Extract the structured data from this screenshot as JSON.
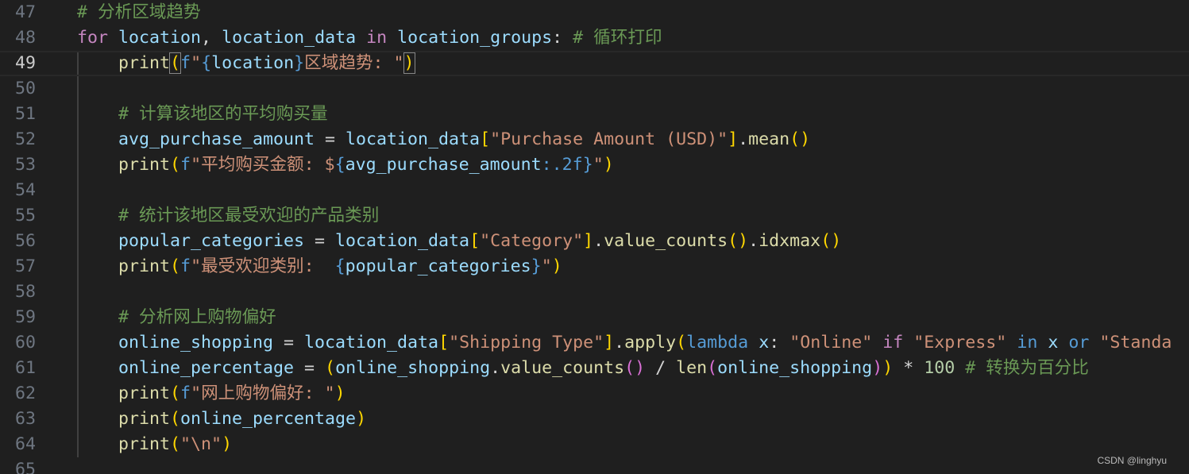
{
  "watermark": "CSDN @linghyu",
  "colors": {
    "background": "#1f1f1f",
    "comment": "#6a9955",
    "keyword": "#c586c0",
    "variable": "#9cdcfe",
    "function": "#dcdcaa",
    "string": "#ce9178",
    "bracket_1": "#ffd700",
    "bracket_2": "#da70d6",
    "bracket_3": "#179fff"
  },
  "current_line": "49",
  "lines": [
    {
      "num": "47",
      "tokens": [
        [
          "cm",
          "# 分析区域趋势"
        ]
      ]
    },
    {
      "num": "48",
      "tokens": [
        [
          "kw",
          "for"
        ],
        [
          "pun",
          " "
        ],
        [
          "var",
          "location"
        ],
        [
          "pun",
          ", "
        ],
        [
          "var",
          "location_data"
        ],
        [
          "pun",
          " "
        ],
        [
          "kw",
          "in"
        ],
        [
          "pun",
          " "
        ],
        [
          "var",
          "location_groups"
        ],
        [
          "pun",
          ": "
        ],
        [
          "cm",
          "# 循环打印"
        ]
      ]
    },
    {
      "num": "49",
      "tokens": [
        [
          "pun",
          "    "
        ],
        [
          "fn",
          "print"
        ],
        [
          "b1 match",
          "("
        ],
        [
          "sk",
          "f"
        ],
        [
          "str",
          "\""
        ],
        [
          "sk",
          "{"
        ],
        [
          "var",
          "location"
        ],
        [
          "sk",
          "}"
        ],
        [
          "str",
          "区域趋势: \""
        ],
        [
          "b1 match",
          ")"
        ]
      ]
    },
    {
      "num": "50",
      "tokens": []
    },
    {
      "num": "51",
      "tokens": [
        [
          "pun",
          "    "
        ],
        [
          "cm",
          "# 计算该地区的平均购买量"
        ]
      ]
    },
    {
      "num": "52",
      "tokens": [
        [
          "pun",
          "    "
        ],
        [
          "var",
          "avg_purchase_amount"
        ],
        [
          "pun",
          " = "
        ],
        [
          "var",
          "location_data"
        ],
        [
          "b1",
          "["
        ],
        [
          "str",
          "\"Purchase Amount (USD)\""
        ],
        [
          "b1",
          "]"
        ],
        [
          "pun",
          "."
        ],
        [
          "fn",
          "mean"
        ],
        [
          "b1",
          "()"
        ]
      ]
    },
    {
      "num": "53",
      "tokens": [
        [
          "pun",
          "    "
        ],
        [
          "fn",
          "print"
        ],
        [
          "b1",
          "("
        ],
        [
          "sk",
          "f"
        ],
        [
          "str",
          "\"平均购买金额: $"
        ],
        [
          "sk",
          "{"
        ],
        [
          "var",
          "avg_purchase_amount"
        ],
        [
          "sk",
          ":.2f}"
        ],
        [
          "str",
          "\""
        ],
        [
          "b1",
          ")"
        ]
      ]
    },
    {
      "num": "54",
      "tokens": []
    },
    {
      "num": "55",
      "tokens": [
        [
          "pun",
          "    "
        ],
        [
          "cm",
          "# 统计该地区最受欢迎的产品类别"
        ]
      ]
    },
    {
      "num": "56",
      "tokens": [
        [
          "pun",
          "    "
        ],
        [
          "var",
          "popular_categories"
        ],
        [
          "pun",
          " = "
        ],
        [
          "var",
          "location_data"
        ],
        [
          "b1",
          "["
        ],
        [
          "str",
          "\"Category\""
        ],
        [
          "b1",
          "]"
        ],
        [
          "pun",
          "."
        ],
        [
          "fn",
          "value_counts"
        ],
        [
          "b1",
          "()"
        ],
        [
          "pun",
          "."
        ],
        [
          "fn",
          "idxmax"
        ],
        [
          "b1",
          "()"
        ]
      ]
    },
    {
      "num": "57",
      "tokens": [
        [
          "pun",
          "    "
        ],
        [
          "fn",
          "print"
        ],
        [
          "b1",
          "("
        ],
        [
          "sk",
          "f"
        ],
        [
          "str",
          "\"最受欢迎类别:  "
        ],
        [
          "sk",
          "{"
        ],
        [
          "var",
          "popular_categories"
        ],
        [
          "sk",
          "}"
        ],
        [
          "str",
          "\""
        ],
        [
          "b1",
          ")"
        ]
      ]
    },
    {
      "num": "58",
      "tokens": []
    },
    {
      "num": "59",
      "tokens": [
        [
          "pun",
          "    "
        ],
        [
          "cm",
          "# 分析网上购物偏好"
        ]
      ]
    },
    {
      "num": "60",
      "tokens": [
        [
          "pun",
          "    "
        ],
        [
          "var",
          "online_shopping"
        ],
        [
          "pun",
          " = "
        ],
        [
          "var",
          "location_data"
        ],
        [
          "b1",
          "["
        ],
        [
          "str",
          "\"Shipping Type\""
        ],
        [
          "b1",
          "]"
        ],
        [
          "pun",
          "."
        ],
        [
          "fn",
          "apply"
        ],
        [
          "b1",
          "("
        ],
        [
          "sk",
          "lambda"
        ],
        [
          "pun",
          " "
        ],
        [
          "var",
          "x"
        ],
        [
          "pun",
          ": "
        ],
        [
          "str",
          "\"Online\""
        ],
        [
          "pun",
          " "
        ],
        [
          "kw",
          "if"
        ],
        [
          "pun",
          " "
        ],
        [
          "str",
          "\"Express\""
        ],
        [
          "pun",
          " "
        ],
        [
          "sk",
          "in"
        ],
        [
          "pun",
          " "
        ],
        [
          "var",
          "x"
        ],
        [
          "pun",
          " "
        ],
        [
          "sk",
          "or"
        ],
        [
          "pun",
          " "
        ],
        [
          "str",
          "\"Standa"
        ]
      ]
    },
    {
      "num": "61",
      "tokens": [
        [
          "pun",
          "    "
        ],
        [
          "var",
          "online_percentage"
        ],
        [
          "pun",
          " = "
        ],
        [
          "b1",
          "("
        ],
        [
          "var",
          "online_shopping"
        ],
        [
          "pun",
          "."
        ],
        [
          "fn",
          "value_counts"
        ],
        [
          "b2",
          "()"
        ],
        [
          "pun",
          " / "
        ],
        [
          "fn",
          "len"
        ],
        [
          "b2",
          "("
        ],
        [
          "var",
          "online_shopping"
        ],
        [
          "b2",
          ")"
        ],
        [
          "b1",
          ")"
        ],
        [
          "pun",
          " * "
        ],
        [
          "num",
          "100"
        ],
        [
          "pun",
          " "
        ],
        [
          "cm",
          "# 转换为百分比"
        ]
      ]
    },
    {
      "num": "62",
      "tokens": [
        [
          "pun",
          "    "
        ],
        [
          "fn",
          "print"
        ],
        [
          "b1",
          "("
        ],
        [
          "sk",
          "f"
        ],
        [
          "str",
          "\"网上购物偏好: \""
        ],
        [
          "b1",
          ")"
        ]
      ]
    },
    {
      "num": "63",
      "tokens": [
        [
          "pun",
          "    "
        ],
        [
          "fn",
          "print"
        ],
        [
          "b1",
          "("
        ],
        [
          "var",
          "online_percentage"
        ],
        [
          "b1",
          ")"
        ]
      ]
    },
    {
      "num": "64",
      "tokens": [
        [
          "pun",
          "    "
        ],
        [
          "fn",
          "print"
        ],
        [
          "b1",
          "("
        ],
        [
          "str",
          "\"\\n\""
        ],
        [
          "b1",
          ")"
        ]
      ]
    },
    {
      "num": "65",
      "tokens": []
    }
  ]
}
